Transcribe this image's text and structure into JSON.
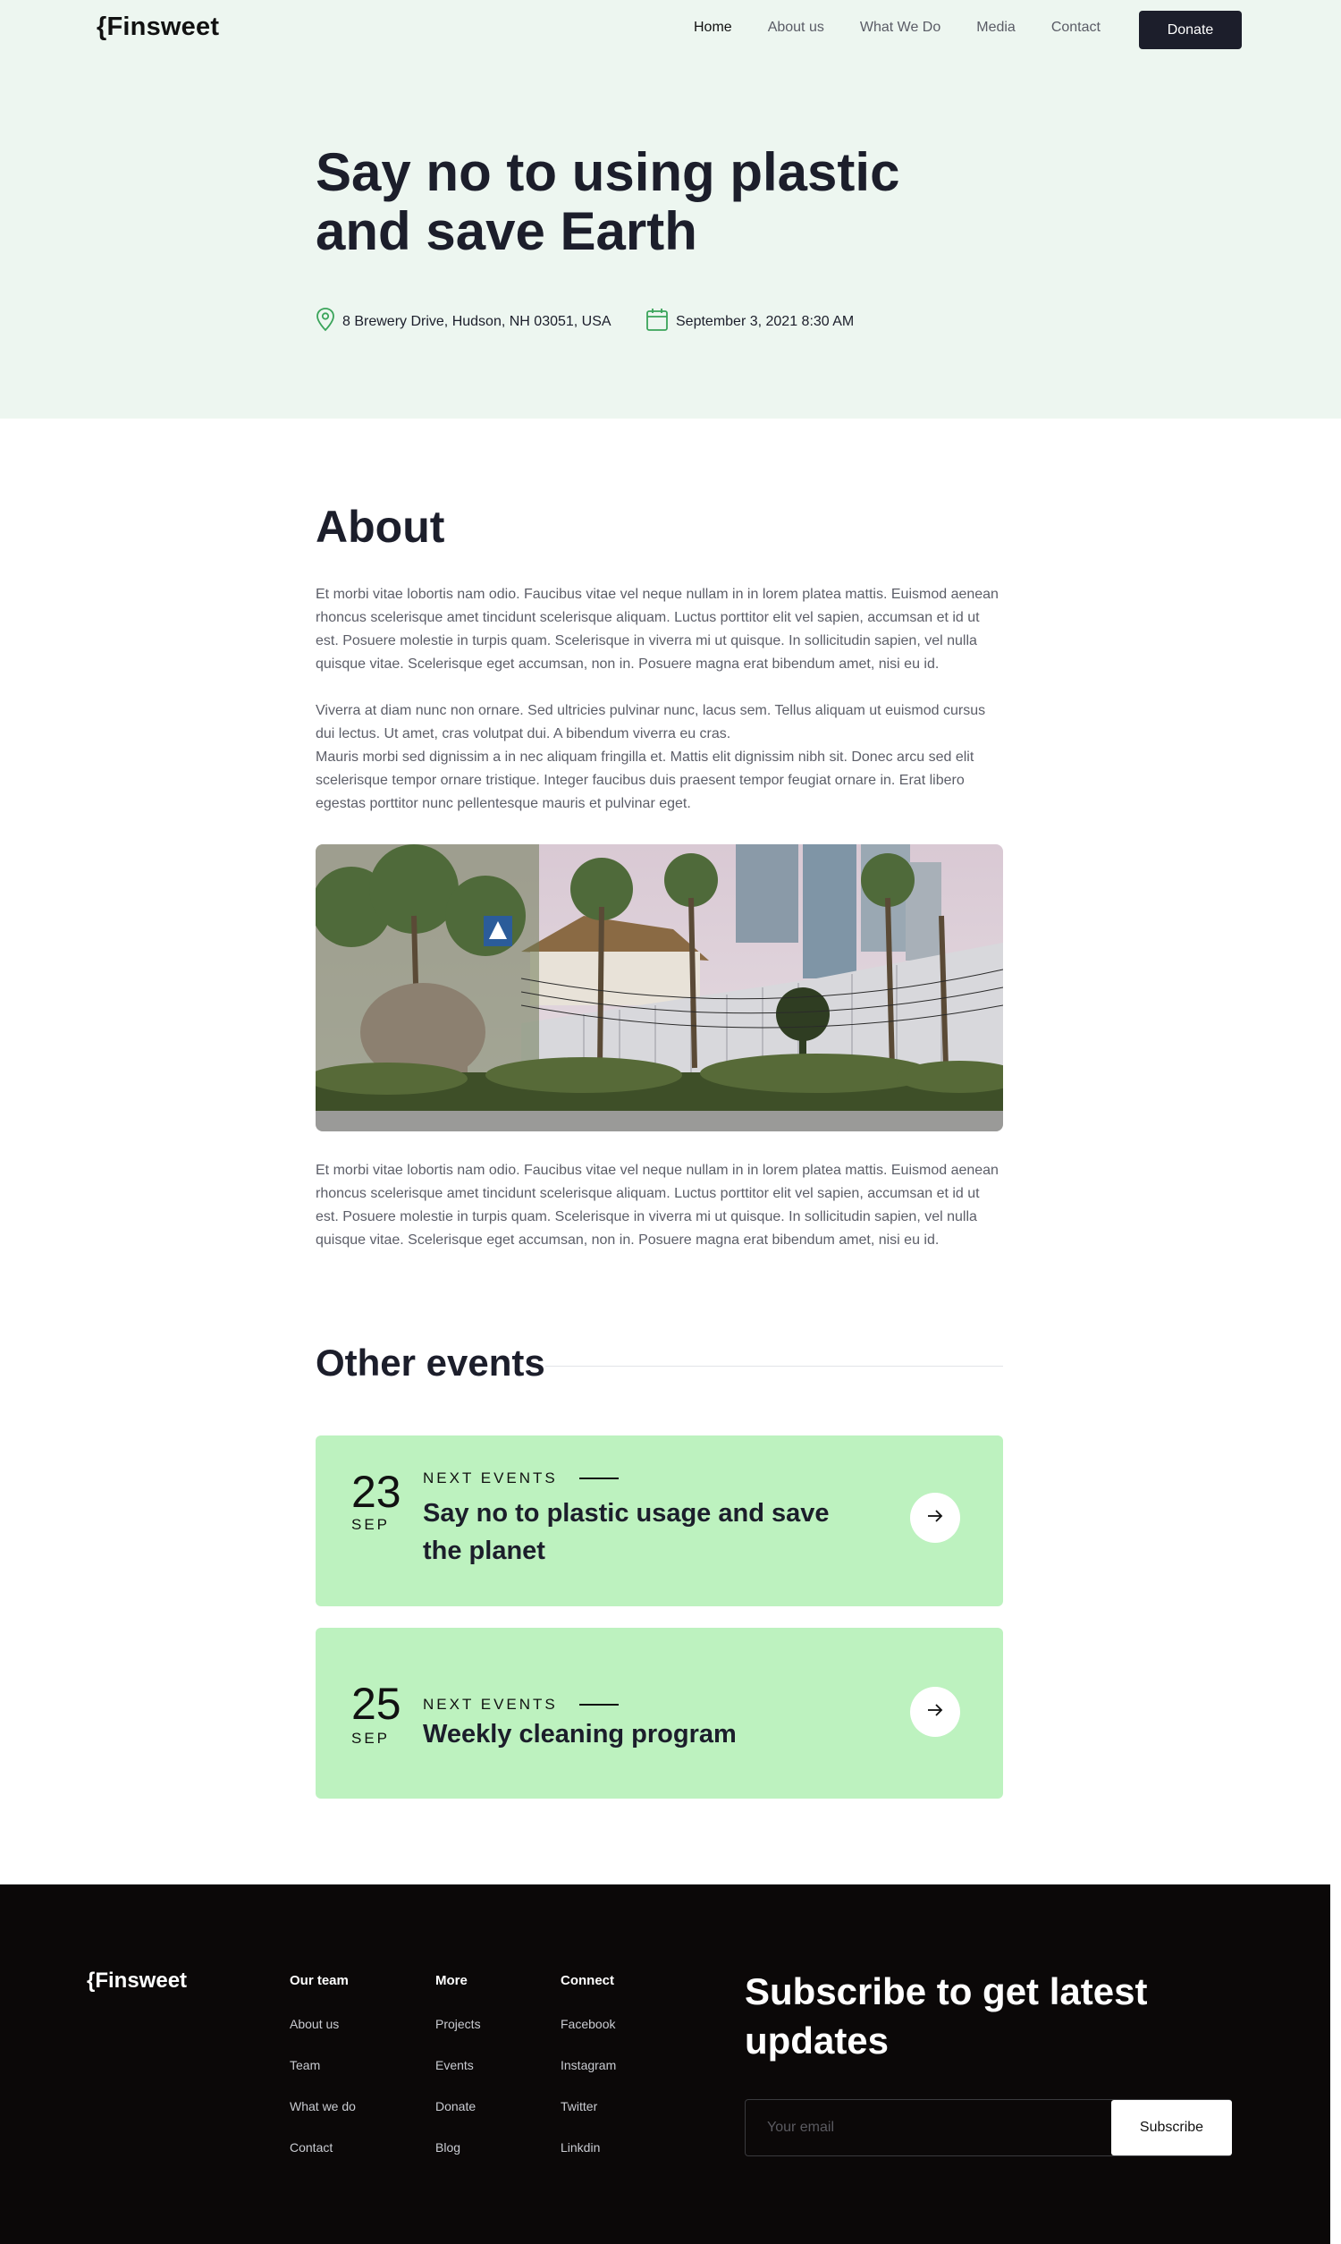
{
  "nav": {
    "logo": "{Finsweet",
    "links": [
      "Home",
      "About us",
      "What We Do",
      "Media",
      "Contact"
    ],
    "donate_label": "Donate"
  },
  "hero": {
    "title": "Say no to using plastic and save Earth",
    "location": "8 Brewery Drive, Hudson, NH 03051, USA",
    "datetime": "September 3, 2021 8:30 AM",
    "accent_color": "#3aa45a"
  },
  "about": {
    "title": "About",
    "paragraph1": "Et morbi vitae lobortis nam odio. Faucibus vitae vel neque nullam in in lorem platea mattis. Euismod aenean rhoncus scelerisque amet tincidunt scelerisque aliquam. Luctus porttitor elit vel sapien, accumsan et id ut est. Posuere molestie in turpis quam. Scelerisque in viverra mi ut quisque. In sollicitudin sapien, vel nulla quisque vitae. Scelerisque eget accumsan, non in. Posuere magna erat bibendum amet, nisi eu id.",
    "paragraph2a": "Viverra at diam nunc non ornare. Sed ultricies pulvinar nunc, lacus sem. Tellus aliquam ut euismod cursus dui lectus. Ut amet, cras volutpat dui. A bibendum viverra eu cras.",
    "paragraph2b": "Mauris morbi sed dignissim a in nec aliquam fringilla et. Mattis elit dignissim nibh sit. Donec arcu sed elit scelerisque tempor ornare tristique. Integer faucibus duis praesent tempor feugiat ornare in. Erat libero egestas porttitor nunc pellentesque mauris et pulvinar eget.",
    "paragraph3": "Et morbi vitae lobortis nam odio. Faucibus vitae vel neque nullam in in lorem platea mattis. Euismod aenean rhoncus scelerisque amet tincidunt scelerisque aliquam. Luctus porttitor elit vel sapien, accumsan et id ut est. Posuere molestie in turpis quam. Scelerisque in viverra mi ut quisque. In sollicitudin sapien, vel nulla quisque vitae. Scelerisque eget accumsan, non in. Posuere magna erat bibendum amet, nisi eu id."
  },
  "other_events": {
    "title": "Other events",
    "card_color": "#bdf2bf",
    "events": [
      {
        "day": "23",
        "month": "SEP",
        "tag": "NEXT EVENTS",
        "title": "Say no to plastic usage and save the planet"
      },
      {
        "day": "25",
        "month": "SEP",
        "tag": "NEXT EVENTS",
        "title": "Weekly cleaning program"
      }
    ]
  },
  "footer": {
    "logo": "{Finsweet",
    "columns": [
      {
        "heading": "Our team",
        "links": [
          "About us",
          "Team",
          "What we do",
          "Contact"
        ]
      },
      {
        "heading": "More",
        "links": [
          "Projects",
          "Events",
          "Donate",
          "Blog"
        ]
      },
      {
        "heading": "Connect",
        "links": [
          "Facebook",
          "Instagram",
          "Twitter",
          "Linkdin"
        ]
      }
    ],
    "subscribe_title": "Subscribe to get latest updates",
    "email_placeholder": "Your email",
    "subscribe_label": "Subscribe"
  }
}
